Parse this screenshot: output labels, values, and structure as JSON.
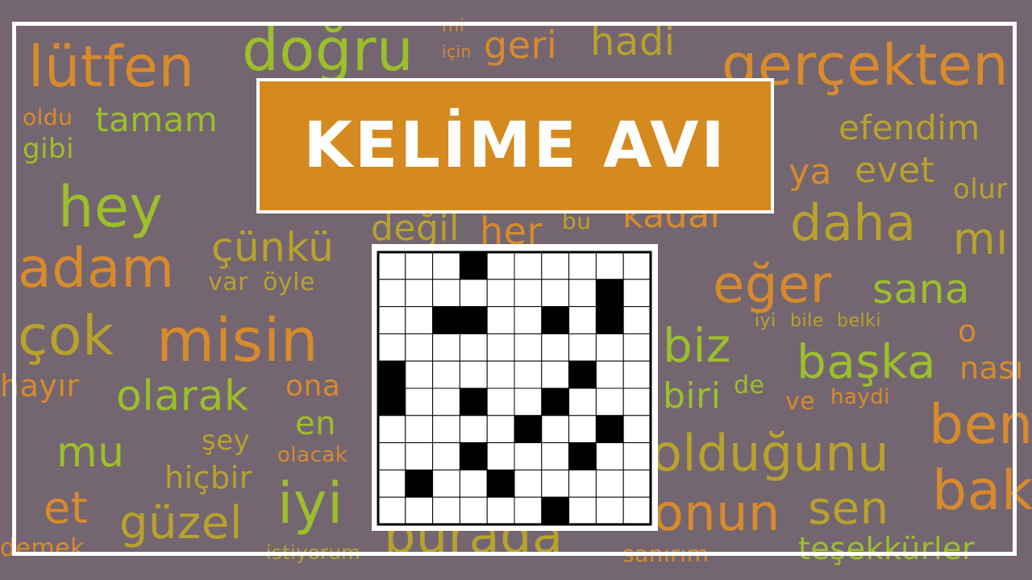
{
  "title": "KELİME AVI",
  "colors": {
    "background": "#736670",
    "title_box": "#d48a1e",
    "frame": "#ffffff",
    "word_orange": "#d88a2c",
    "word_green": "#9cbf2a",
    "word_olive": "#b8a22c",
    "cell_black": "#000000",
    "cell_white": "#ffffff"
  },
  "words": [
    "lütfen",
    "doğru",
    "mi",
    "için",
    "geri",
    "hadi",
    "gerçekten",
    "oldu",
    "tamam",
    "gibi",
    "efendim",
    "ya",
    "evet",
    "olur",
    "hey",
    "değil",
    "bu",
    "her",
    "kadar",
    "daha",
    "mı",
    "çünkü",
    "adam",
    "var",
    "öyle",
    "eğer",
    "sana",
    "iyi",
    "bile",
    "belki",
    "çok",
    "misin",
    "biz",
    "o",
    "başka",
    "nası",
    "hayır",
    "olarak",
    "ona",
    "biri",
    "de",
    "ve",
    "haydi",
    "en",
    "ben",
    "mu",
    "şey",
    "olacak",
    "olduğunu",
    "hiçbir",
    "et",
    "güzel",
    "bak",
    "sen",
    "onun",
    "demek",
    "istiyorum",
    "burada",
    "sanırım",
    "teşekkürler"
  ],
  "puzzle": {
    "rows": 10,
    "cols": 10,
    "black_cells": [
      [
        0,
        3
      ],
      [
        1,
        8
      ],
      [
        2,
        2
      ],
      [
        2,
        3
      ],
      [
        2,
        6
      ],
      [
        2,
        8
      ],
      [
        4,
        0
      ],
      [
        4,
        7
      ],
      [
        5,
        0
      ],
      [
        5,
        3
      ],
      [
        5,
        6
      ],
      [
        6,
        5
      ],
      [
        6,
        8
      ],
      [
        7,
        3
      ],
      [
        7,
        7
      ],
      [
        8,
        1
      ],
      [
        8,
        4
      ],
      [
        9,
        6
      ]
    ]
  }
}
